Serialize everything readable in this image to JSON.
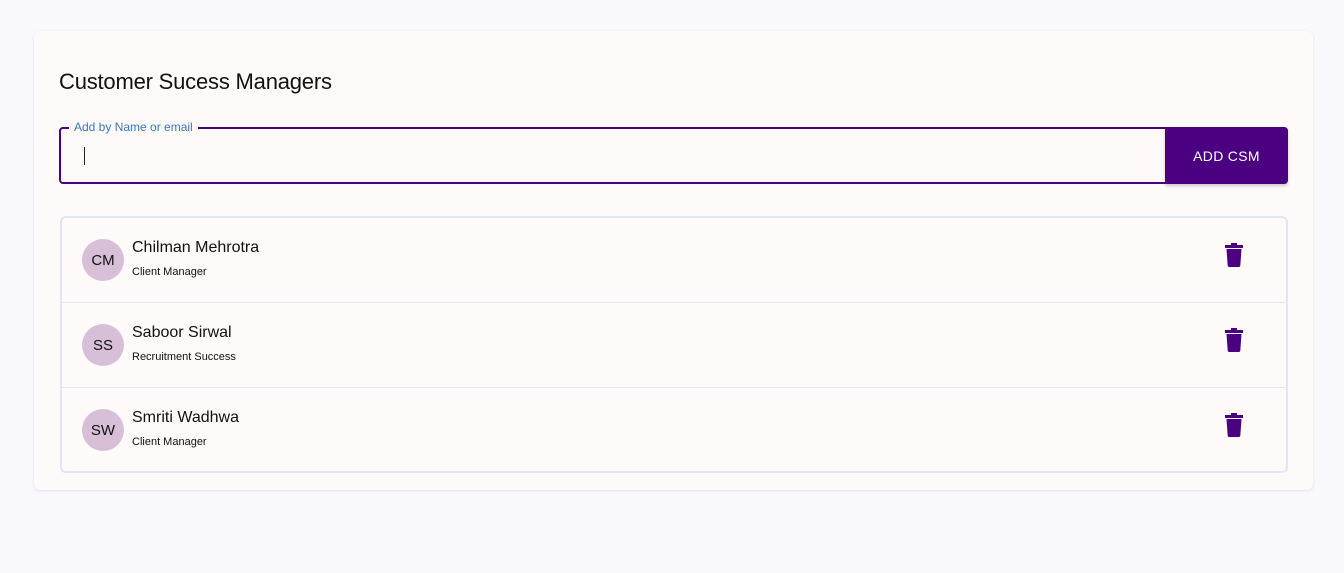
{
  "page": {
    "title": "Customer Sucess Managers"
  },
  "search": {
    "label": "Add by Name or email",
    "value": "",
    "placeholder": ""
  },
  "add_button": {
    "label": "ADD CSM"
  },
  "managers": [
    {
      "initials": "CM",
      "name": "Chilman Mehrotra",
      "role": "Client Manager"
    },
    {
      "initials": "SS",
      "name": "Saboor Sirwal",
      "role": "Recruitment Success"
    },
    {
      "initials": "SW",
      "name": "Smriti Wadhwa",
      "role": "Client Manager"
    }
  ],
  "icons": {
    "delete": "trash-icon"
  },
  "colors": {
    "primary": "#4b0082",
    "avatar_bg": "#d8bfd8",
    "label_blue": "#3a76c2"
  }
}
